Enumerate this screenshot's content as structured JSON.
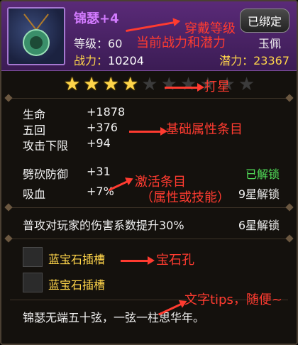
{
  "item": {
    "name": "锦瑟+4",
    "bound": "已绑定",
    "level_label": "等级：",
    "level_value": "60",
    "type": "玉佩",
    "combat_label": "战力：",
    "combat_value": "10204",
    "potential_label": "潜力：",
    "potential_value": "23367",
    "star_count_filled": 4,
    "star_count_total": 10
  },
  "base_attributes": [
    {
      "name": "生命",
      "value": "+1878"
    },
    {
      "name": "五回",
      "value": "+376"
    },
    {
      "name": "攻击下限",
      "value": "+94"
    }
  ],
  "activated_attributes": [
    {
      "name": "劈砍防御",
      "value": "+31",
      "status": "已解锁"
    },
    {
      "name": "吸血",
      "value": "+7%",
      "status": "9星解锁"
    }
  ],
  "effect": {
    "text": "普攻对玩家的伤害系数提升30%",
    "status": "6星解锁"
  },
  "gem_slots": [
    {
      "label": "蓝宝石插槽"
    },
    {
      "label": "蓝宝石插槽"
    }
  ],
  "tip_text": "锦瑟无端五十弦，一弦一柱思华年。",
  "annotations": {
    "wear_level": "穿戴等级",
    "combat_potential": "当前战力和潜力",
    "star": "打星",
    "base_attr": "基础属性条目",
    "activated_attr_line1": "激活条目",
    "activated_attr_line2": "（属性或技能）",
    "gem_hole": "宝石孔",
    "tips": "文字tips，随便~"
  },
  "colors": {
    "name": "#d37bff",
    "gold": "#ffd54a",
    "green_unlocked": "#52e05a",
    "annotation_red": "#ff3b30"
  }
}
